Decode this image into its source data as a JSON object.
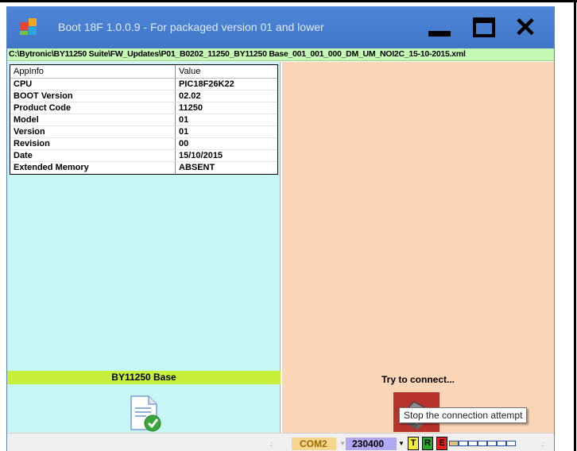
{
  "window": {
    "title": "Boot 18F 1.0.0.9 - For packaged version 01 and lower",
    "close_glyph": "✕",
    "icons": {
      "app": "app-icon",
      "minimize": "minimize-icon",
      "maximize": "maximize-icon",
      "close": "close-icon"
    }
  },
  "path": "C:\\Bytronic\\BY11250 Suite\\FW_Updates\\P01_B0202_11250_BY11250 Base_001_001_000_DM_UM_NOI2C_15-10-2015.xml",
  "app_info": {
    "columns": [
      "AppInfo",
      "Value"
    ],
    "rows": [
      {
        "key": "CPU",
        "value": "PIC18F26K22"
      },
      {
        "key": "BOOT Version",
        "value": "02.02"
      },
      {
        "key": "Product Code",
        "value": "11250"
      },
      {
        "key": "Model",
        "value": "01"
      },
      {
        "key": "Version",
        "value": "01"
      },
      {
        "key": "Revision",
        "value": "00"
      },
      {
        "key": "Date",
        "value": "15/10/2015"
      },
      {
        "key": "Extended Memory",
        "value": "ABSENT"
      }
    ]
  },
  "left_panel": {
    "device_label": "BY11250 Base",
    "icon": "document-check-icon"
  },
  "right_panel": {
    "status_label": "Try to connect...",
    "icon": "connection-icon"
  },
  "tooltip": "Stop the connection attempt",
  "statusbar": {
    "com_port": "COM2",
    "baud_rate": "230400",
    "leds": {
      "t": "T",
      "r": "R",
      "e": "E"
    },
    "progress_fraction": 0.2
  },
  "colors": {
    "title_bar": "#4f86d8",
    "path_bar": "#c4f7b4",
    "left_pane": "#c8f5f5",
    "right_pane": "#fbd6b6",
    "device_label_bg": "#c6ef3c",
    "com_bg": "#f6d68f",
    "baud_bg": "#b0a8f0"
  }
}
